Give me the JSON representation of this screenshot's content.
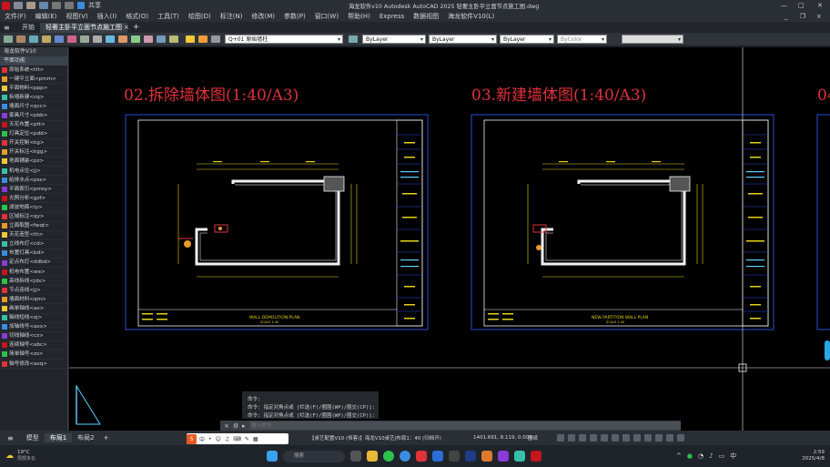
{
  "title_bar": {
    "left_label": "共享",
    "title": "海龙软件v10 Autodesk AutoCAD 2025    轻奢主卧平立面节点施工图.dwg"
  },
  "menu": [
    "文件(F)",
    "编辑(E)",
    "视图(V)",
    "插入(I)",
    "格式(O)",
    "工具(T)",
    "绘图(D)",
    "标注(N)",
    "修改(M)",
    "参数(P)",
    "窗口(W)",
    "帮助(H)",
    "Express",
    "数据视图",
    "海龙软件V10(L)"
  ],
  "doc_tabs": {
    "start": "开始",
    "active": "轻奢主卧平立面节点施工图"
  },
  "toolbar": {
    "layer": "Q+01 原始墙柱",
    "color": "ByLayer",
    "linetype": "ByLayer",
    "lineweight": "ByLayer",
    "plotstyle": "ByColor"
  },
  "palette": {
    "title": "海龙软件V10",
    "section": "平面功能",
    "items": [
      "原始系统<ttt>",
      "一键平立面<pmm>",
      "平面物料<ppp>",
      "拆墙新建<cq>",
      "墙面尺寸<qcc>",
      "家具尺寸<pbb>",
      "天花布置<ptt>",
      "灯具定位<pdd>",
      "开关控制<kg>",
      "开关标注<kgg>",
      "地面铺装<pz>",
      "机电点位<jj>",
      "给排水点<pss>",
      "平面索引<pmsy>",
      "光照分析<gzf>",
      "滤波地面<ly>",
      "区域标注<qy>",
      "立面取图<fwqt>",
      "天花造型<th>",
      "立线布灯<cd>",
      "布置灯具<bd>",
      "定点布灯<ddbd>",
      "机电布置<we>",
      "高线拆线<jdx>",
      "节点连线<jj>",
      "墙面材料<qm>",
      "画单轴线<ax>",
      "轴线短线<zj>",
      "加轴线号<axx>",
      "切线轴线<cz>",
      "连续轴号<abc>",
      "简单轴号<zs>",
      "轴号修改<axq>"
    ]
  },
  "drawings": [
    {
      "title": "02.拆除墙体图(1:40/A3)",
      "plan_label": "WALL DEMOLITION PLAN",
      "sub_label": "SCALE 1:40"
    },
    {
      "title": "03.新建墙体图(1:40/A3)",
      "plan_label": "NEW PARTITION WALL PLAN",
      "sub_label": "SCALE 1:40"
    },
    {
      "title": "04."
    }
  ],
  "command_history": [
    "命令:",
    "命令: 指定对角点或 [栏选(F)/圈围(WP)/圈交(CP)]:",
    "命令: 指定对角点或 [栏选(F)/圈围(WP)/圈交(CP)]:"
  ],
  "command_input": {
    "placeholder": "键入命令"
  },
  "status_bar": {
    "layout_tabs": [
      "模型",
      "布局1",
      "布局2"
    ],
    "active_tab": "布局1",
    "info": "【桌艺配置V10 (恒客)】海龙V10桌艺|布局1：40 (归档开)",
    "coords": "1401.691, 8.119, 0.000",
    "mode": "图纸"
  },
  "taskbar": {
    "weather_temp": "19°C",
    "weather_desc": "局部多云",
    "time": "2:59",
    "date": "2025/4/8",
    "search_placeholder": "搜索"
  },
  "colors": {
    "title_red": "#e0323a",
    "frame_blue": "#2d4bd6",
    "wall_white": "#f2f2f2",
    "dim_yellow": "#e4d317",
    "accent_cyan": "#5fd0ff"
  }
}
